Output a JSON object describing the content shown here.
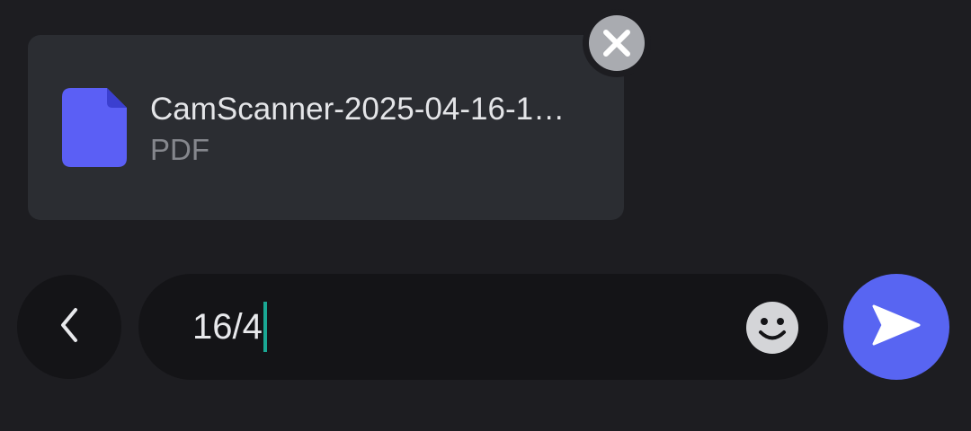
{
  "attachment": {
    "file_name": "CamScanner-2025-04-16-1…",
    "file_type": "PDF",
    "icon": "file-document-icon",
    "icon_color": "#5b5ff5",
    "remove_icon": "close-icon"
  },
  "composer": {
    "back_icon": "chevron-left-icon",
    "message_value": "16/4",
    "emoji_icon": "smiley-icon",
    "send_icon": "send-arrow-icon",
    "send_color": "#5865f2",
    "caret_color": "#1aa894"
  }
}
